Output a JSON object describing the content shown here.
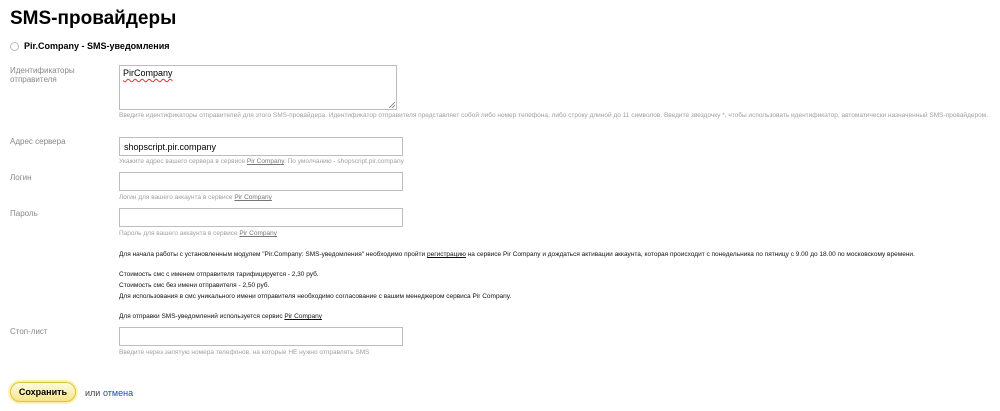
{
  "page": {
    "title": "SMS-провайдеры"
  },
  "provider": {
    "name": "Pir.Company - SMS-уведомления"
  },
  "fields": {
    "sender_ids": {
      "label": "Идентификаторы отправителя",
      "value": "PirCompany",
      "hint": "Введите идентификаторы отправителей для этого SMS-провайдера. Идентификатор отправителя представляет собой либо номер телефона, либо строку длиной до 11 символов. Введите звездочку *, чтобы использовать идентификатор, автоматически назначенный SMS-провайдером."
    },
    "server": {
      "label": "Адрес сервера",
      "value": "shopscript.pir.company",
      "hint_prefix": "Укажите адрес вашего сервера в сервисе",
      "hint_link": "Pir Company",
      "hint_suffix": ". По умолчанию - shopscript.pir.company"
    },
    "login": {
      "label": "Логин",
      "value": "",
      "hint_prefix": "Логин для вашего аккаунта в сервисе",
      "hint_link": "Pir Company"
    },
    "password": {
      "label": "Пароль",
      "value": "",
      "hint_prefix": "Пароль для вашего аккаунта в сервисе",
      "hint_link": "Pir Company"
    },
    "stoplist": {
      "label": "Стоп-лист",
      "value": "",
      "hint": "Введите через запятую номера телефонов, на которые НЕ нужно отправлять SMS"
    }
  },
  "info": {
    "line1_prefix": "Для начала работы с установленным модулем \"Pir.Company: SMS-уведомления\" необходимо пройти",
    "line1_link": "регистрацию",
    "line1_suffix": "на сервисе Pir Company и дождаться активации аккаунта, которая происходит с понедельника по пятницу с 9.00 до 18.00 по московскому времени.",
    "price_with_name": "Стоимость смс с именем отправителя тарифицируется - 2,30 руб.",
    "price_without_name": "Стоимость смс без имени отправителя - 2,50 руб.",
    "unique_name": "Для использования в смс уникального имени отправителя необходимо согласование с вашим менеджером сервиса Pir Company.",
    "service_prefix": "Для отправки SMS-уведомлений используется сервис",
    "service_link": "Pir Company"
  },
  "actions": {
    "save_label": "Сохранить",
    "or_text": "или",
    "cancel_label": "отмена"
  }
}
